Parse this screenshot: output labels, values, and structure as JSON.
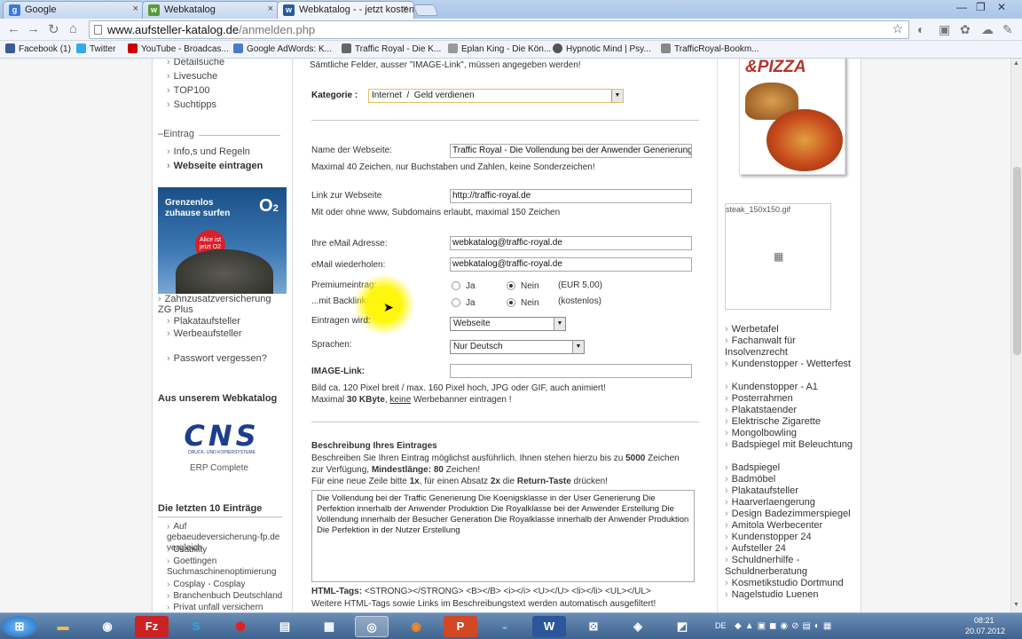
{
  "browser": {
    "tabs": [
      {
        "label": "Google",
        "icon": "google-icon",
        "color": "#3b78e7"
      },
      {
        "label": "Webkatalog",
        "icon": "webkatalog-icon",
        "color": "#5a9a3a"
      },
      {
        "label": "Webkatalog - - jetzt kosten",
        "icon": "webkatalog-icon",
        "color": "#2a5ba0"
      }
    ],
    "url_domain": "www.aufsteller-katalog.de",
    "url_path": "/anmelden.php",
    "bookmarks": [
      {
        "label": "Facebook (1)",
        "color": "#3b5998"
      },
      {
        "label": "Twitter",
        "color": "#33aaee"
      },
      {
        "label": "YouTube - Broadcas...",
        "color": "#cc0000"
      },
      {
        "label": "Google AdWords: K...",
        "color": "#4a7bd0"
      },
      {
        "label": "Traffic Royal - Die K...",
        "color": "#666666"
      },
      {
        "label": "Eplan King - Die Kön...",
        "color": "#999999"
      },
      {
        "label": "Hypnotic Mind | Psy...",
        "color": "#555555"
      },
      {
        "label": "TrafficRoyal-Bookm...",
        "color": "#888888"
      }
    ]
  },
  "left": {
    "links_top": [
      "Detailsuche",
      "Livesuche",
      "TOP100",
      "Suchtipps"
    ],
    "entry_heading": "Eintrag",
    "entry_links": [
      "Info,s und Regeln",
      "Webseite eintragen"
    ],
    "ad": {
      "line1": "Grenzenlos",
      "line2": "zuhause surfen",
      "brand": "O",
      "badge": "Alice ist jetzt O2"
    },
    "more_links": [
      "Zahnzusatzversicherung ZG Plus",
      "Plakataufsteller",
      "Werbeaufsteller"
    ],
    "forgot": "Passwort vergessen?",
    "partner_heading": "Aus unserem Webkatalog",
    "cns_logo": "CNS",
    "cns_sub": "DRUCK- UND KOPIERSYSTEME",
    "cns_caption": "ERP Complete",
    "recent_heading": "Die letzten 10 Einträge",
    "recent": [
      "Auf gebaeudeversicherung-fp.de vergleich",
      "Usability",
      "Goettingen Suchmaschinenoptimierung",
      "Cosplay - Cosplay",
      "Branchenbuch Deutschland",
      "Privat unfall versichern"
    ]
  },
  "form": {
    "intro": "Sämtliche Felder, ausser \"IMAGE-Link\", müssen angegeben werden!",
    "kategorie_label": "Kategorie :",
    "kategorie_value": "Internet  /  Geld verdienen",
    "name_label": "Name der Webseite:",
    "name_value": "Traffic Royal - Die Vollendung bei der Anwender Generierung",
    "name_hint": "Maximal 40 Zeichen, nur Buchstaben und Zahlen, keine Sonderzeichen!",
    "link_label": "Link zur Webseite",
    "link_value": "http://traffic-royal.de",
    "link_hint": "Mit oder ohne www, Subdomains erlaubt, maximal 150 Zeichen",
    "email_label": "Ihre eMail Adresse:",
    "email_value": "webkatalog@traffic-royal.de",
    "email2_label": "eMail wiederholen:",
    "email2_value": "webkatalog@traffic-royal.de",
    "premium_label": "Premiumeintrag:",
    "premium_ja": "Ja",
    "premium_nein": "Nein",
    "premium_price": "(EUR 5,00)",
    "backlink_label": "...mit Backlink:",
    "backlink_ja": "Ja",
    "backlink_nein": "Nein",
    "backlink_price": "(kostenlos)",
    "eintragen_label": "Eintragen wird:",
    "eintragen_value": "Webseite",
    "sprachen_label": "Sprachen:",
    "sprachen_value": "Nur Deutsch",
    "image_label": "IMAGE-Link:",
    "image_value": "",
    "image_hint1": "Bild ca. 120 Pixel breit / max. 160 Pixel hoch, JPG oder GIF, auch animiert!",
    "image_hint2_pre": "Maximal ",
    "image_hint2_bold": "30 KByte",
    "image_hint2_mid": ", ",
    "image_hint2_link": "keine",
    "image_hint2_post": " Werbebanner eintragen !",
    "desc_heading": "Beschreibung Ihres Eintrages",
    "desc_hint1_pre": "Beschreiben Sie Ihren Eintrag möglichst ausführlich. Ihnen stehen hierzu bis zu ",
    "desc_hint1_bold": "5000",
    "desc_hint1_post": " Zeichen",
    "desc_hint2_pre": "zur Verfügung, ",
    "desc_hint2_bold": "Mindestlänge: 80",
    "desc_hint2_post": " Zeichen!",
    "desc_hint3_pre": "Für eine neue Zeile bitte ",
    "desc_hint3_b1": "1x",
    "desc_hint3_mid": ", für einen Absatz ",
    "desc_hint3_b2": "2x",
    "desc_hint3_mid2": " die ",
    "desc_hint3_b3": "Return-Taste",
    "desc_hint3_post": " drücken!",
    "desc_value": "Die Vollendung bei der Traffic Generierung Die Koenigsklasse in der User Generierung Die Perfektion innerhalb der Anwender Produktion Die Royalklasse bei der Anwender Erstellung Die Vollendung innerhalb der Besucher Generation Die Royalklasse innerhalb der Anwender Produktion Die Perfektion in der Nutzer Erstellung",
    "html_tags_label": "HTML-Tags:",
    "html_tags_value": " <STRONG></STRONG> <B></B> <i></i> <U></U> <li></li> <UL></UL>",
    "html_tags_hint": "Weitere HTML-Tags sowie Links im Beschreibungstext werden automatisch ausgefiltert!"
  },
  "right": {
    "pizza_text": "&PIZZA",
    "steak_caption": "steak_150x150.gif",
    "links": [
      "Werbetafel",
      "Fachanwalt für Insolvenzrecht",
      "Kundenstopper - Wetterfest",
      "Kundenstopper - A1",
      "Posterrahmen",
      "Plakatstaender",
      "Elektrische Zigarette",
      "Mongolbowling",
      "Badspiegel mit Beleuchtung",
      "Badspiegel",
      "Badmöbel",
      "Plakataufsteller",
      "Haarverlaengerung",
      "Design Badezimmerspiegel",
      "Amitola Werbecenter",
      "Kundenstopper 24",
      "Aufsteller 24",
      "Schuldnerhilfe - Schuldnerberatung",
      "Kosmetikstudio Dortmund",
      "Nagelstudio Luenen"
    ]
  },
  "taskbar": {
    "lang": "DE",
    "time": "08:21",
    "date": "20.07.2012"
  }
}
